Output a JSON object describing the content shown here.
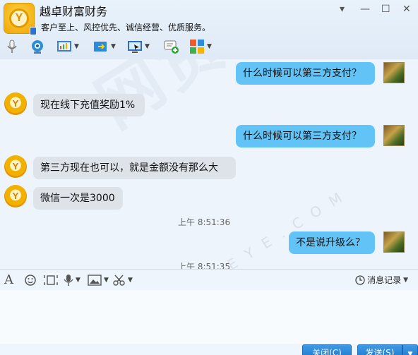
{
  "window": {
    "title": "越卓财富财务",
    "subtitle": "客户至上、风控优先、诚信经营、优质服务。",
    "logo_text": "Y",
    "controls": [
      "▾",
      "—",
      "☐",
      "✕"
    ]
  },
  "toolbar": {
    "icons": [
      "microphone-icon",
      "video-camera-icon",
      "chart-icon",
      "file-transfer-icon",
      "screen-share-icon",
      "message-add-icon",
      "apps-grid-icon"
    ]
  },
  "messages": [
    {
      "sender": "me",
      "text": "什么时候可以第三方支付？"
    },
    {
      "sender": "them",
      "text": "现在线下充值奖励1%"
    },
    {
      "sender": "me",
      "text": "什么时候可以第三方支付？"
    },
    {
      "sender": "them",
      "text": "第三方现在也可以，就是金额没有那么大"
    },
    {
      "sender": "them",
      "text": "微信一次是3000"
    },
    {
      "sender": "time",
      "text": "上午 8:51:36"
    },
    {
      "sender": "me",
      "text": "不是说升级么？"
    },
    {
      "sender": "time",
      "text": "上午 8:51:35"
    }
  ],
  "watermark": {
    "main": "网贷天眼",
    "sub": "P2PEYE.COM"
  },
  "input_toolbar": {
    "icons": [
      "font-icon",
      "emoji-icon",
      "capture-icon",
      "voice-icon",
      "image-icon",
      "scissors-icon"
    ],
    "history_label": "消息记录"
  },
  "buttons": {
    "close_label": "关闭(C)",
    "send_label": "发送(S)"
  }
}
